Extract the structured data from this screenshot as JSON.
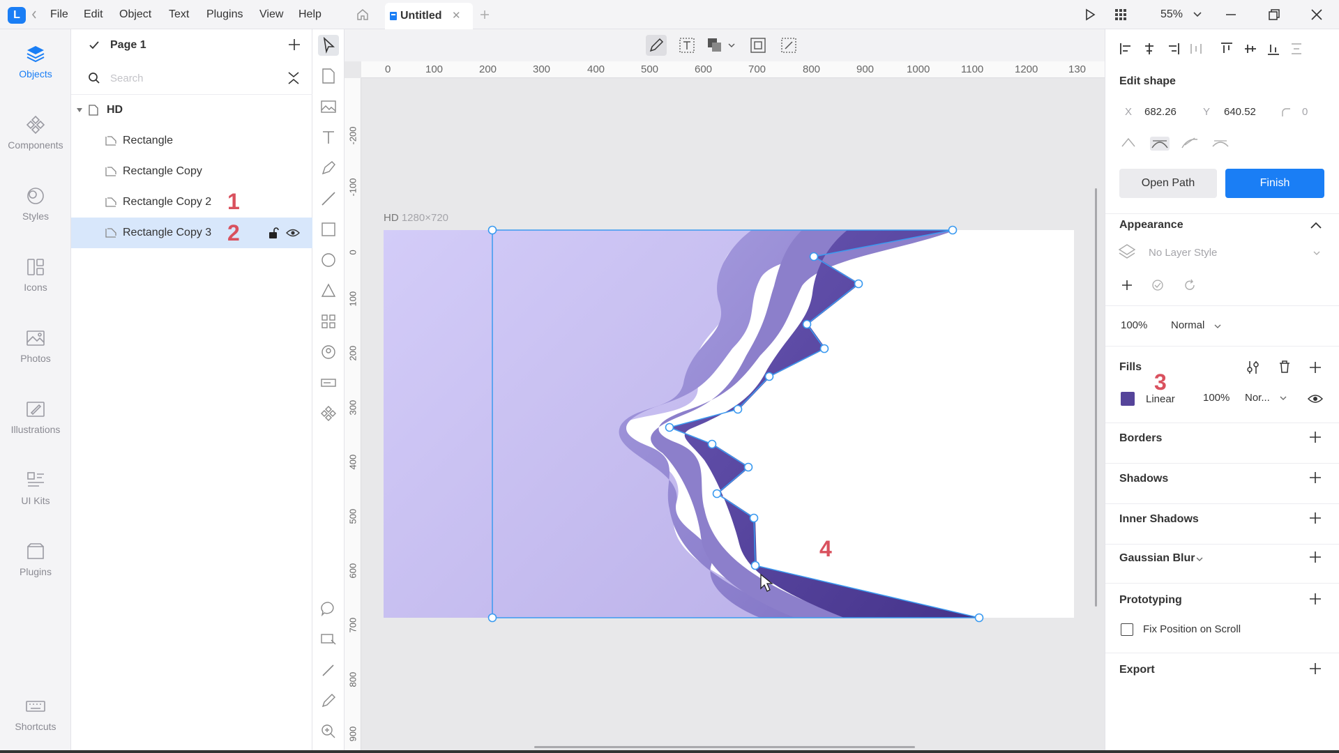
{
  "menu": {
    "items": [
      "File",
      "Edit",
      "Object",
      "Text",
      "Plugins",
      "View",
      "Help"
    ]
  },
  "tabs": {
    "title": "Untitled"
  },
  "zoom": {
    "level": "55%"
  },
  "nav": {
    "items": [
      "Objects",
      "Components",
      "Styles",
      "Icons",
      "Photos",
      "Illustrations",
      "UI Kits",
      "Plugins"
    ],
    "shortcuts": "Shortcuts"
  },
  "layers": {
    "page": "Page 1",
    "search_placeholder": "Search",
    "artboard": "HD",
    "items": [
      "Rectangle",
      "Rectangle Copy",
      "Rectangle Copy 2",
      "Rectangle Copy 3"
    ]
  },
  "annotations": [
    "1",
    "2",
    "3",
    "4"
  ],
  "rulers": {
    "h": [
      "0",
      "100",
      "200",
      "300",
      "400",
      "500",
      "600",
      "700",
      "800",
      "900",
      "1000",
      "1100",
      "1200",
      "130"
    ],
    "v": [
      "-200",
      "-100",
      "0",
      "100",
      "200",
      "300",
      "400",
      "500",
      "600",
      "700",
      "800",
      "900"
    ]
  },
  "artboard": {
    "name": "HD",
    "size": "1280×720"
  },
  "inspector": {
    "edit_shape": "Edit shape",
    "x_label": "X",
    "x_value": "682.26",
    "y_label": "Y",
    "y_value": "640.52",
    "radius_value": "0",
    "open_path": "Open Path",
    "finish": "Finish",
    "appearance": "Appearance",
    "layer_style": "No Layer Style",
    "opacity": "100%",
    "blend": "Normal",
    "fills": "Fills",
    "fill_type": "Linear",
    "fill_opacity": "100%",
    "fill_blend": "Nor...",
    "borders": "Borders",
    "shadows": "Shadows",
    "inner_shadows": "Inner Shadows",
    "gaussian_blur": "Gaussian Blur",
    "prototyping": "Prototyping",
    "fix_position": "Fix Position on Scroll",
    "export": "Export"
  },
  "colors": {
    "accent": "#1a7ef5",
    "annotation": "#d9515e",
    "fill_swatch": "#55449a",
    "wave_light": "#ccc6f6",
    "wave_mid": "#9487cf",
    "wave_dark": "#52409a"
  }
}
